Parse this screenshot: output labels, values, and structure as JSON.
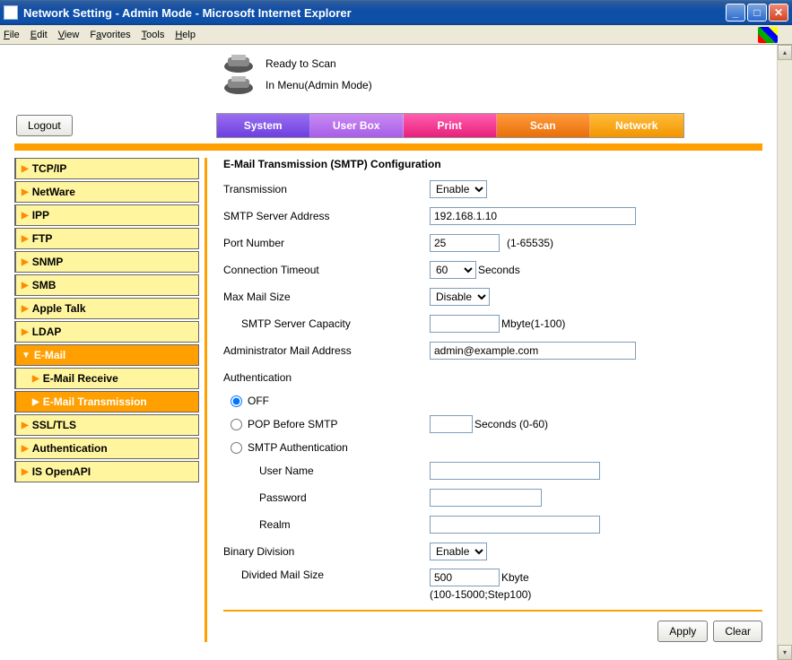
{
  "window": {
    "title": "Network Setting - Admin Mode - Microsoft Internet Explorer"
  },
  "menu": {
    "file": "File",
    "edit": "Edit",
    "view": "View",
    "favorites": "Favorites",
    "tools": "Tools",
    "help": "Help"
  },
  "status": {
    "line1": "Ready to Scan",
    "line2": "In Menu(Admin Mode)"
  },
  "buttons": {
    "logout": "Logout",
    "apply": "Apply",
    "clear": "Clear"
  },
  "tabs": {
    "system": "System",
    "userbox": "User Box",
    "print": "Print",
    "scan": "Scan",
    "network": "Network"
  },
  "sidebar": {
    "items": [
      {
        "label": "TCP/IP"
      },
      {
        "label": "NetWare"
      },
      {
        "label": "IPP"
      },
      {
        "label": "FTP"
      },
      {
        "label": "SNMP"
      },
      {
        "label": "SMB"
      },
      {
        "label": "Apple Talk"
      },
      {
        "label": "LDAP"
      },
      {
        "label": "E-Mail"
      },
      {
        "label": "E-Mail Receive"
      },
      {
        "label": "E-Mail Transmission"
      },
      {
        "label": "SSL/TLS"
      },
      {
        "label": "Authentication"
      },
      {
        "label": "IS OpenAPI"
      }
    ]
  },
  "config": {
    "title": "E-Mail Transmission (SMTP) Configuration",
    "labels": {
      "transmission": "Transmission",
      "smtp_server": "SMTP Server Address",
      "port": "Port Number",
      "conn_timeout": "Connection Timeout",
      "max_mail": "Max Mail Size",
      "smtp_capacity": "SMTP Server Capacity",
      "admin_mail": "Administrator Mail Address",
      "authentication": "Authentication",
      "auth_off": "OFF",
      "auth_pop": "POP Before SMTP",
      "auth_smtp": "SMTP Authentication",
      "username": "User Name",
      "password": "Password",
      "realm": "Realm",
      "binary_div": "Binary Division",
      "div_mail_size": "Divided Mail Size"
    },
    "values": {
      "transmission": "Enable",
      "smtp_server": "192.168.1.10",
      "port": "25",
      "conn_timeout": "60",
      "max_mail": "Disable",
      "smtp_capacity": "",
      "admin_mail": "admin@example.com",
      "pop_seconds": "",
      "username": "",
      "password": "",
      "realm": "",
      "binary_div": "Enable",
      "div_mail_size": "500"
    },
    "hints": {
      "port": "(1-65535)",
      "conn_timeout": "Seconds",
      "smtp_capacity": "Mbyte(1-100)",
      "pop_seconds": "Seconds (0-60)",
      "div_mail_unit": "Kbyte",
      "div_mail_range": "(100-15000;Step100)"
    }
  }
}
